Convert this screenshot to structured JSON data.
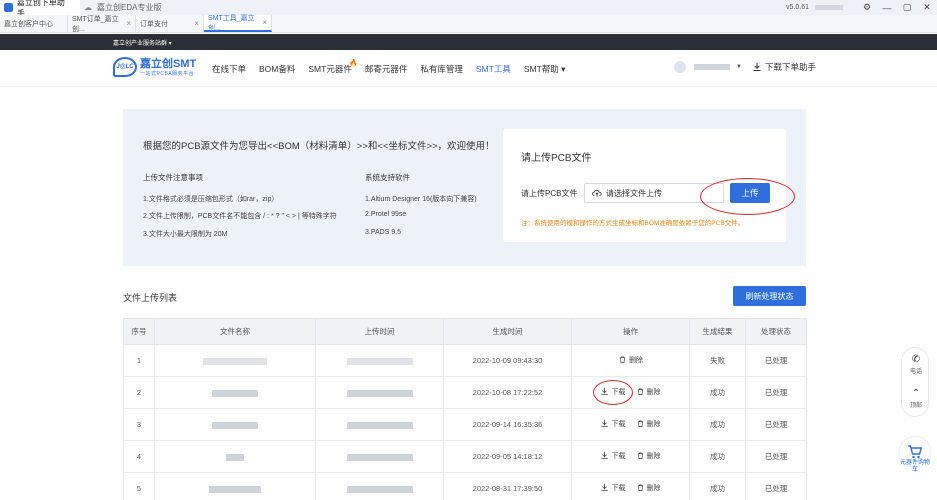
{
  "window": {
    "app_title": "嘉立创下单助手",
    "second_app": "嘉立创EDA专业版",
    "version": "v5.0.61",
    "controls": [
      "⚙",
      "—",
      "▢",
      "✕"
    ]
  },
  "tabs": [
    {
      "label": "嘉立创客户中心",
      "active": false
    },
    {
      "label": "SMT订单_嘉立创...",
      "active": false
    },
    {
      "label": "订单支付",
      "active": false
    },
    {
      "label": "SMT工具_嘉立创...",
      "active": true
    }
  ],
  "header": {
    "service_group": "嘉立创产业服务站群 ▾"
  },
  "nav": {
    "logo_badge": "J@LC",
    "logo_title": "嘉立创SMT",
    "logo_sub": "一站式PCBA服务平台",
    "items": [
      {
        "label": "在线下单",
        "active": false
      },
      {
        "label": "BOM备料",
        "active": false
      },
      {
        "label": "SMT元器件",
        "active": false,
        "hot": true
      },
      {
        "label": "邮寄元器件",
        "active": false
      },
      {
        "label": "私有库管理",
        "active": false
      },
      {
        "label": "SMT工具",
        "active": true
      },
      {
        "label": "SMT帮助 ▾",
        "active": false
      }
    ],
    "download_helper": "下载下单助手"
  },
  "upload_panel": {
    "intro": "根据您的PCB源文件为您导出<<BOM（材料清单）>>和<<坐标文件>>，欢迎使用！",
    "notes_title": "上传文件注意事项",
    "notes": [
      "1.文件格式必须是压缩包形式（如rar，zip）",
      "2.文件上传限制，PCB文件名不能包含 / : * ? \" < > | 等特殊字符",
      "3.文件大小最大限制为 20M"
    ],
    "software_title": "系统支持软件",
    "software": [
      "1.Altium Designer 16(版本向下兼容)",
      "2.Protel 99se",
      "3.PADS 9.5"
    ],
    "card_title": "请上传PCB文件",
    "card_label": "请上传PCB文件",
    "file_placeholder": "请选择文件上传",
    "upload_button": "上传",
    "warning": "注：系统使用的模和操作的方式生成坐标和BOM准确度依赖于您的PCB文件。"
  },
  "file_list": {
    "title": "文件上传列表",
    "refresh_button": "刷新处理状态",
    "columns": [
      "序号",
      "文件名称",
      "上传时间",
      "生成时间",
      "操作",
      "生成结果",
      "处理状态"
    ],
    "rows": [
      {
        "no": "1",
        "generated": "2022-10-09 09:43:30",
        "ops": [
          "删除"
        ],
        "result": "失败",
        "status": "已处理"
      },
      {
        "no": "2",
        "generated": "2022-10-08 17:22:52",
        "ops": [
          "下载",
          "删除"
        ],
        "result": "成功",
        "status": "已处理"
      },
      {
        "no": "3",
        "generated": "2022-09-14 16:35:36",
        "ops": [
          "下载",
          "删除"
        ],
        "result": "成功",
        "status": "已处理"
      },
      {
        "no": "4",
        "generated": "2022-09-05 14:18:12",
        "ops": [
          "下载",
          "删除"
        ],
        "result": "成功",
        "status": "已处理"
      },
      {
        "no": "5",
        "generated": "2022-08-31 17:39:50",
        "ops": [
          "下载",
          "删除"
        ],
        "result": "成功",
        "status": "已处理"
      }
    ]
  },
  "float_tools": {
    "phone": "电话",
    "top": "顶部",
    "cart": "元器件购物车"
  },
  "colors": {
    "accent": "#2f6fdc",
    "fail": "#e53935",
    "success": "#2e9d3a",
    "warning": "#e8840e",
    "annotation": "#d52b2b"
  }
}
